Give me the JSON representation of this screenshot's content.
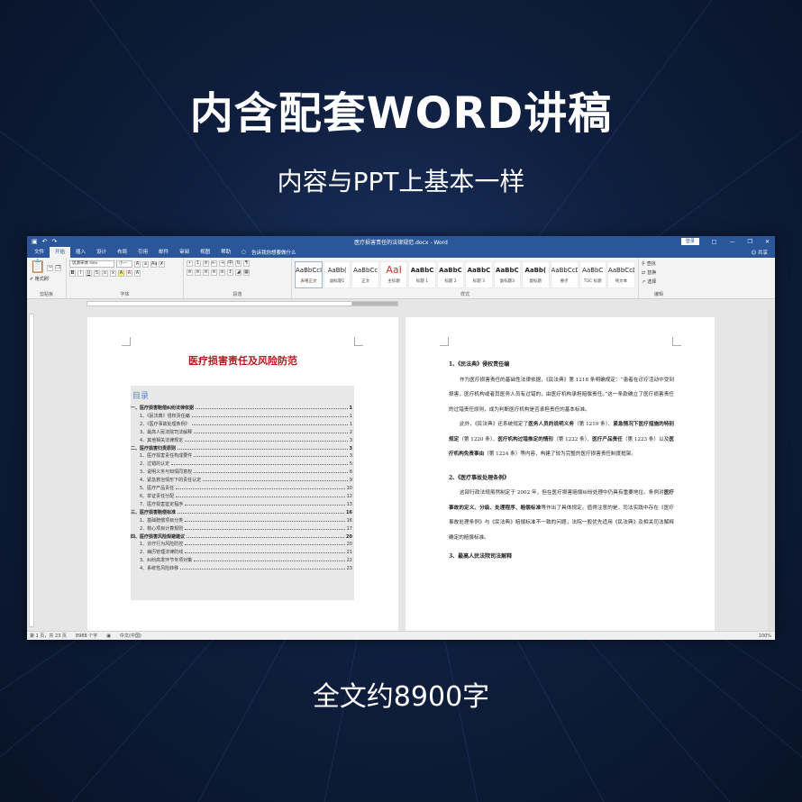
{
  "banner": {
    "headline": "内含配套WORD讲稿",
    "subline": "内容与PPT上基本一样",
    "footline": "全文约8900字"
  },
  "window": {
    "title": "医疗损害责任的法律规范.docx - Word",
    "login": "登录",
    "share": "共享",
    "tabs": [
      "文件",
      "开始",
      "插入",
      "设计",
      "布局",
      "引用",
      "邮件",
      "审阅",
      "视图",
      "帮助"
    ],
    "tell_me": "告诉我你想要做什么",
    "ribbon": {
      "clipboard_label": "剪贴板",
      "paste_label": "格式刷",
      "font_label": "字体",
      "font_name": "思源宋体 Hev",
      "font_size": "小一",
      "paragraph_label": "段落",
      "styles_label": "样式",
      "editing_label": "编辑",
      "find": "查找",
      "replace": "替换",
      "select": "选择",
      "styles": [
        {
          "preview": "AaBbCcI",
          "name": "表格正文"
        },
        {
          "preview": "AaBb(",
          "name": "副标题1"
        },
        {
          "preview": "AaBbCc",
          "name": "正文"
        },
        {
          "preview": "AaI",
          "name": "主标题"
        },
        {
          "preview": "AaBbC",
          "name": "标题 1"
        },
        {
          "preview": "AaBbC",
          "name": "标题 2"
        },
        {
          "preview": "AaBbC",
          "name": "标题 3"
        },
        {
          "preview": "AaBbC",
          "name": "副标题3"
        },
        {
          "preview": "AaBb(",
          "name": "副标题"
        },
        {
          "preview": "AaBbCcD",
          "name": "要点"
        },
        {
          "preview": "AaBbC",
          "name": "TOC 标题"
        },
        {
          "preview": "AaBbCcDd",
          "name": "纯文本"
        }
      ]
    },
    "status": {
      "page": "第 1 页，共 23 页",
      "words": "8988 个字",
      "lang": "中文(中国)",
      "zoom": "100%"
    }
  },
  "left_page": {
    "heading": "医疗损害责任及风险防范",
    "toc_title": "目录",
    "toc": [
      {
        "level": 1,
        "text": "一、医疗损害赔偿纠纷法律依据",
        "page": "1"
      },
      {
        "level": 2,
        "text": "1、《民法典》侵权责任编",
        "page": "1"
      },
      {
        "level": 2,
        "text": "2、《医疗事故处理条例》",
        "page": "1"
      },
      {
        "level": 2,
        "text": "3、最高人民法院司法解释",
        "page": "2"
      },
      {
        "level": 2,
        "text": "4、其他相关法律规定",
        "page": "3"
      },
      {
        "level": 1,
        "text": "二、医疗损害归责原则",
        "page": "3"
      },
      {
        "level": 2,
        "text": "1、医疗损害责任构成要件",
        "page": "3"
      },
      {
        "level": 2,
        "text": "2、过错的认定",
        "page": "5"
      },
      {
        "level": 2,
        "text": "3、说明义务与知情同意权",
        "page": "6"
      },
      {
        "level": 2,
        "text": "4、紧急救治情形下的责任认定",
        "page": "9"
      },
      {
        "level": 2,
        "text": "5、医疗产品责任",
        "page": "10"
      },
      {
        "level": 2,
        "text": "6、举证责任分配",
        "page": "12"
      },
      {
        "level": 2,
        "text": "7、医疗损害鉴定程序",
        "page": "13"
      },
      {
        "level": 1,
        "text": "三、医疗损害赔偿标准",
        "page": "16"
      },
      {
        "level": 2,
        "text": "1、基础赔偿项目分类",
        "page": "16"
      },
      {
        "level": 2,
        "text": "2、核心项目计算规则",
        "page": "17"
      },
      {
        "level": 1,
        "text": "四、医疗损害风险规避建议",
        "page": "20"
      },
      {
        "level": 2,
        "text": "1、诊疗行为风险防控",
        "page": "20"
      },
      {
        "level": 2,
        "text": "2、病历管理法律防线",
        "page": "21"
      },
      {
        "level": 2,
        "text": "3、纠纷高发环节专项对策",
        "page": "22"
      },
      {
        "level": 2,
        "text": "4、系统性风险转移",
        "page": "23"
      }
    ]
  },
  "right_page": {
    "sec1_heading": "1、《民法典》侵权责任编",
    "sec1_p1": "作为医疗损害责任的基础性法律依据，《民法典》第 1218 条明确规定：“患者在诊疗活动中受到损害，医疗机构或者其医务人员有过错的，由医疗机构承担赔偿责任。”这一条款确立了医疗损害责任的过错责任原则，成为判断医疗机构是否承担责任的基本标准。",
    "sec1_p2a": "此外，《民法典》还系统规定了",
    "sec1_p2b": "医务人员的说明义务",
    "sec1_p2c": "（第 1219 条）、",
    "sec1_p2d": "紧急情况下医疗措施的特别规定",
    "sec1_p2e": "（第 1220 条）、",
    "sec1_p2f": "医疗机构过错推定的情形",
    "sec1_p2g": "（第 1222 条）、",
    "sec1_p2h": "医疗产品责任",
    "sec1_p2i": "（第 1223 条）以及",
    "sec1_p2j": "医疗机构免责事由",
    "sec1_p2k": "（第 1224 条）等内容，构建了较为完整的医疗损害责任制度框架。",
    "sec2_heading": "2、《医疗事故处理条例》",
    "sec2_p1a": "这部行政法规虽然制定于 2002 年，但在医疗损害赔偿纠纷处理中仍具有重要地位。条例对",
    "sec2_p1b": "医疗事故的定义、分级、处理程序、赔偿标准",
    "sec2_p1c": "等作出了具体规定。值得注意的是，司法实践中存在《医疗事故处理条例》与《民法典》赔偿标准不一致的问题，法院一般优先适用《民法典》及相关司法解释确定的赔偿标准。",
    "sec3_heading": "3、最高人民法院司法解释"
  }
}
